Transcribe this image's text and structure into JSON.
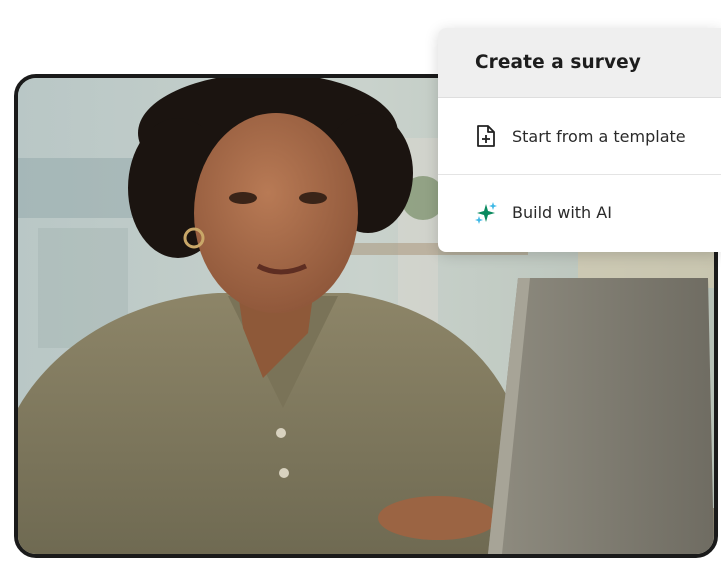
{
  "menu": {
    "title": "Create a survey",
    "items": [
      {
        "label": "Start from a template",
        "icon": "file-plus-icon"
      },
      {
        "label": "Build with AI",
        "icon": "sparkle-icon"
      }
    ]
  },
  "photo": {
    "subject": "woman-typing-on-laptop-icon"
  },
  "colors": {
    "ai_sparkle_primary": "#0a8a5f",
    "ai_sparkle_secondary": "#3fb8e6",
    "frame_border": "#1a1a1a",
    "menu_header_bg": "#efefef"
  }
}
